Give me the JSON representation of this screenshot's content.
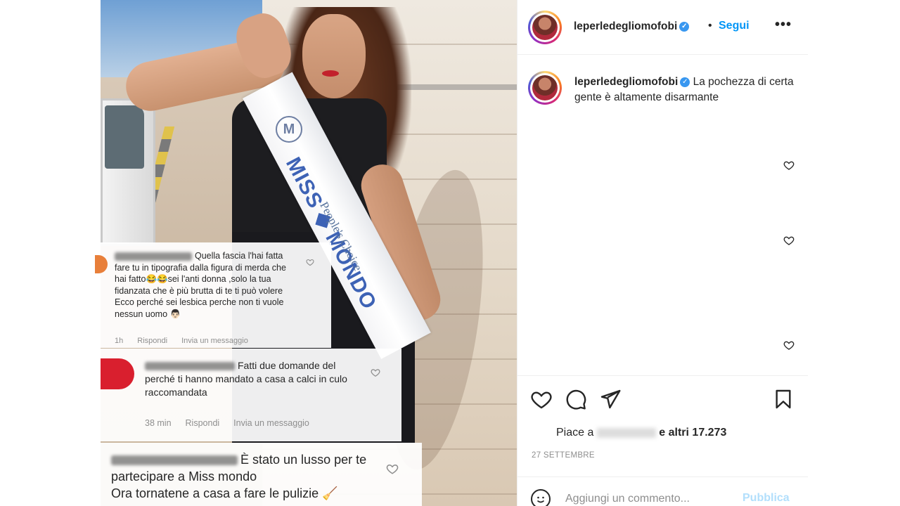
{
  "post": {
    "username": "leperledegliomofobi",
    "follow_label": "Segui",
    "dot": "•",
    "more": "•••",
    "caption": "La pochezza di certa gente è altamente disarmante",
    "likes_prefix": "Piace a",
    "likes_suffix": "e altri 17.273",
    "date": "27 SETTEMBRE",
    "comment_placeholder": "Aggiungi un commento...",
    "publish_label": "Pubblica"
  },
  "sash": {
    "logo": "M",
    "line1": "MISS ◆ MONDO",
    "line2": "People's Choice"
  },
  "overlay_comments": [
    {
      "name_tail": "Quella fascia l'hai fatta fare tu in tipografia dalla figura di merda che hai fatto😂😂sei l'anti donna ,solo la tua fidanzata che è più brutta di te ti può volere",
      "line2": "Ecco perché sei lesbica perche non ti vuole nessun uomo 👨🏻",
      "time": "1h",
      "reply": "Rispondi",
      "message": "Invia un messaggio"
    },
    {
      "text": "Fatti due domande del perché ti hanno mandato a casa a calci in culo raccomandata",
      "time": "38 min",
      "reply": "Rispondi",
      "message": "Invia un messaggio"
    },
    {
      "text": "È stato un lusso per te partecipare a Miss mondo",
      "line2": "Ora tornatene a casa a fare le pulizie 🧹"
    }
  ],
  "colors": {
    "link_blue": "#0095f6",
    "verified_blue": "#3897f0",
    "muted": "#8e8e8e",
    "publish_disabled": "#b2dffc"
  },
  "icons": [
    "verified-icon",
    "heart-icon",
    "comment-icon",
    "share-icon",
    "bookmark-icon",
    "emoji-icon",
    "more-icon"
  ]
}
